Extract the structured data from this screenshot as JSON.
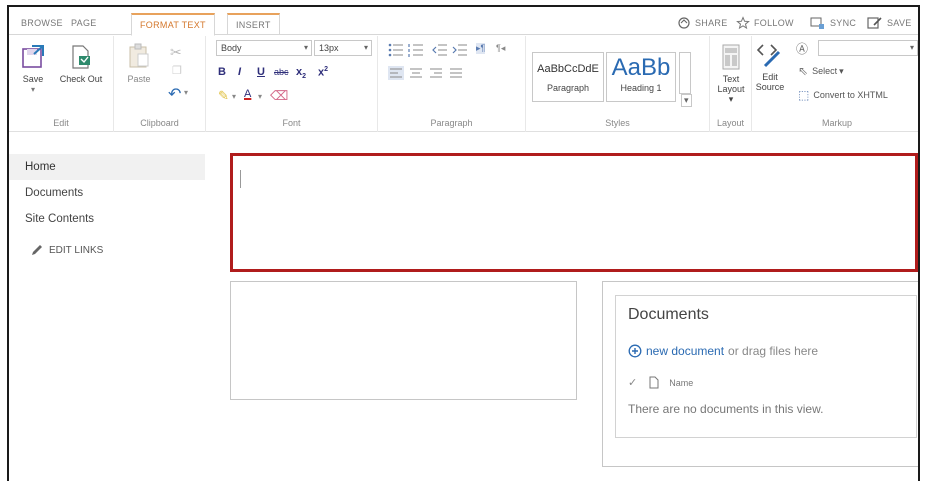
{
  "ribbon_tabs": {
    "browse": "BROWSE",
    "page": "PAGE",
    "format_text": "FORMAT TEXT",
    "insert": "INSERT"
  },
  "top_actions": {
    "share": "SHARE",
    "follow": "FOLLOW",
    "sync": "SYNC",
    "save": "SAVE"
  },
  "ribbon": {
    "edit": {
      "save": "Save",
      "check_out": "Check Out",
      "group_label": "Edit"
    },
    "clipboard": {
      "paste": "Paste",
      "group_label": "Clipboard"
    },
    "font": {
      "font_name": "Body",
      "font_size": "13px",
      "bold": "B",
      "italic": "I",
      "underline": "U",
      "strikethrough": "abc",
      "subscript": "x",
      "superscript": "x",
      "font_color_letter": "A",
      "group_label": "Font"
    },
    "paragraph": {
      "group_label": "Paragraph"
    },
    "styles": {
      "paragraph_sample": "AaBbCcDdE",
      "paragraph_label": "Paragraph",
      "heading_sample": "AaBb",
      "heading_label": "Heading 1",
      "group_label": "Styles"
    },
    "layout": {
      "text_layout_line1": "Text",
      "text_layout_line2": "Layout",
      "group_label": "Layout"
    },
    "markup": {
      "edit_source_line1": "Edit",
      "edit_source_line2": "Source",
      "select": "Select",
      "convert": "Convert to XHTML",
      "group_label": "Markup"
    }
  },
  "nav": {
    "items": [
      "Home",
      "Documents",
      "Site Contents"
    ],
    "edit_links": "EDIT LINKS"
  },
  "documents_webpart": {
    "title": "Documents",
    "new_link": "new document",
    "new_rest": "or drag files here",
    "column_name": "Name",
    "empty_message": "There are no documents in this view."
  },
  "colors": {
    "accent_orange": "#e8a25c",
    "edit_border_red": "#b01c1c",
    "link_blue": "#2a6ab2"
  }
}
